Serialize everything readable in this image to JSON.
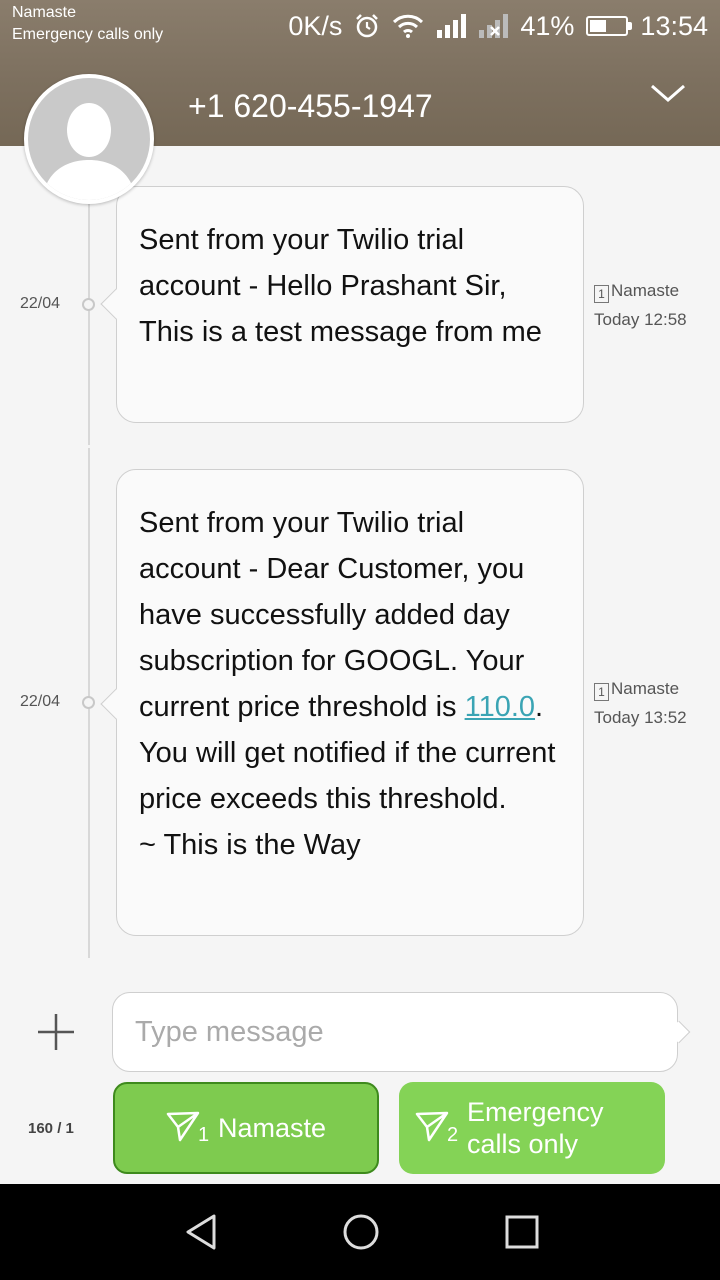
{
  "status_bar": {
    "carrier": "Namaste",
    "network_note": "Emergency calls only",
    "speed": "0K/s",
    "battery": "41%",
    "battery_level": 0.41,
    "time": "13:54"
  },
  "conversation": {
    "contact": "+1 620-455-1947"
  },
  "messages": [
    {
      "date": "22/04",
      "text_parts": [
        "Sent from your Twilio trial account - Hello Prashant Sir, This is a test message from me"
      ],
      "sim_label": "1",
      "sim_name": "Namaste",
      "time": "Today 12:58"
    },
    {
      "date": "22/04",
      "text_parts": [
        "Sent from your Twilio trial account - Dear Customer, you have successfully added day subscription for GOOGL. Your current price threshold is ",
        "110.0",
        ". You will get notified if the current price exceeds this threshold.",
        "~ This is the Way"
      ],
      "sim_label": "1",
      "sim_name": "Namaste",
      "time": "Today 13:52"
    }
  ],
  "composer": {
    "placeholder": "Type message",
    "char_count": "160 / 1",
    "send_sim1": {
      "index": "1",
      "label": "Namaste"
    },
    "send_sim2": {
      "index": "2",
      "label_line1": "Emergency",
      "label_line2": "calls only"
    }
  },
  "colors": {
    "header_bg": "#7d705f",
    "send_button": "#7ecb4f",
    "link": "#3aa4b4"
  },
  "icons": [
    "avatar-silhouette",
    "chevron-down-icon",
    "plus-icon",
    "send-icon",
    "alarm-icon",
    "wifi-icon",
    "signal-icon",
    "back-icon",
    "home-icon",
    "recents-icon"
  ]
}
